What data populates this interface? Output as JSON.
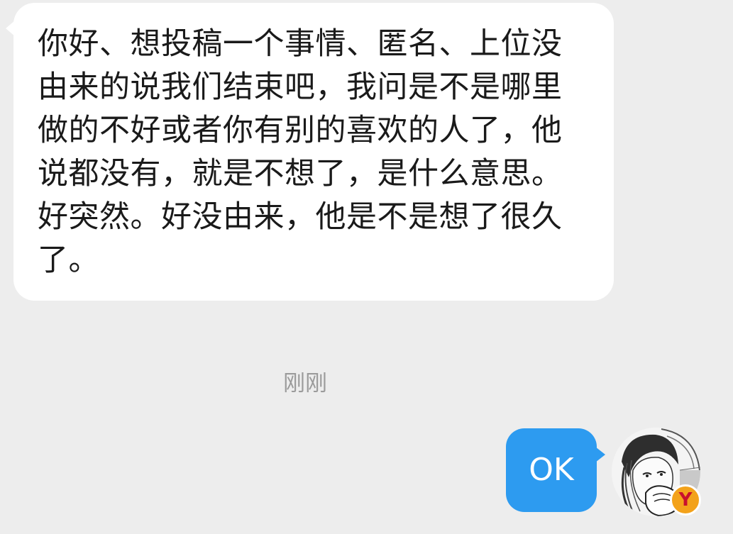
{
  "incoming_message": {
    "text": "你好、想投稿一个事情、匿名、上位没由来的说我们结束吧，我问是不是哪里做的不好或者你有别的喜欢的人了，他说都没有，就是不想了，是什么意思。好突然。好没由来，他是不是想了很久了。"
  },
  "timestamp": "刚刚",
  "outgoing_message": {
    "text": "OK"
  },
  "avatar": {
    "badge_letter": "Y",
    "badge_color": "#f3a21a"
  },
  "colors": {
    "background": "#ededed",
    "incoming_bubble": "#ffffff",
    "outgoing_bubble": "#2d9bf0",
    "timestamp_text": "#9b9b9b"
  }
}
